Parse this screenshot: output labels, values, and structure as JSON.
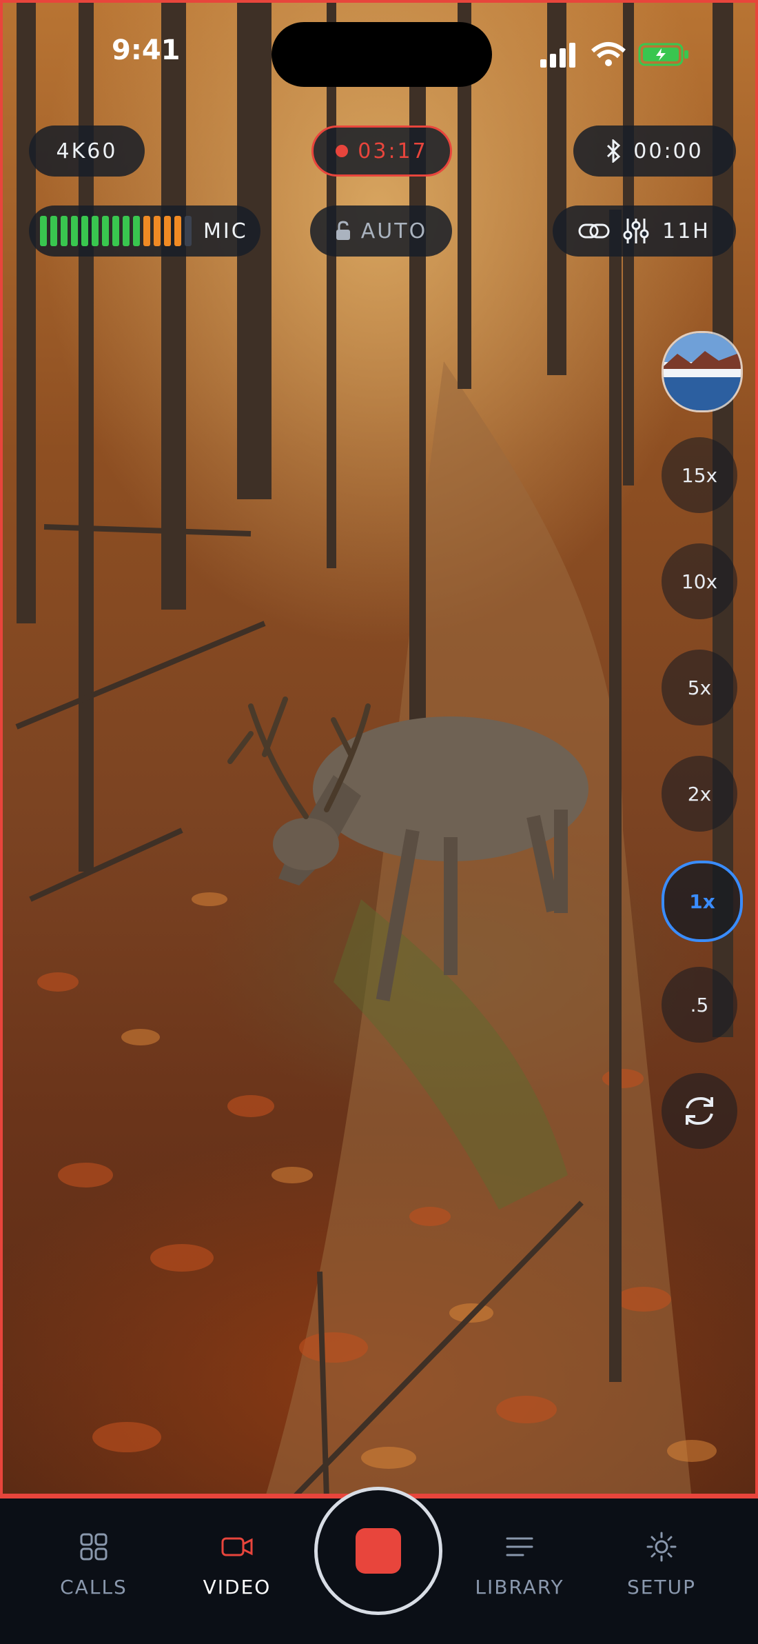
{
  "status_bar": {
    "time": "9:41"
  },
  "hud": {
    "resolution": "4K60",
    "recording_time": "03:17",
    "bluetooth_timer": "00:00",
    "mic_label": "MIC",
    "mic_level": {
      "green_bars": 10,
      "orange_bars": 4,
      "total_bars": 15
    },
    "exposure_mode": "AUTO",
    "hours_label": "11H"
  },
  "zoom": {
    "levels": [
      "15x",
      "10x",
      "5x",
      "2x",
      "1x",
      ".5"
    ],
    "active": "1x"
  },
  "tabs": [
    {
      "label": "CALLS",
      "icon": "grid-icon"
    },
    {
      "label": "VIDEO",
      "icon": "video-camera-icon",
      "active": true
    },
    {
      "label": "LIBRARY",
      "icon": "list-icon"
    },
    {
      "label": "SETUP",
      "icon": "gear-icon"
    }
  ],
  "colors": {
    "accent_red": "#e8453c",
    "accent_blue": "#3a8dff",
    "mic_green": "#39c64f",
    "mic_orange": "#f08a24",
    "tab_inactive": "#8a98ad"
  }
}
